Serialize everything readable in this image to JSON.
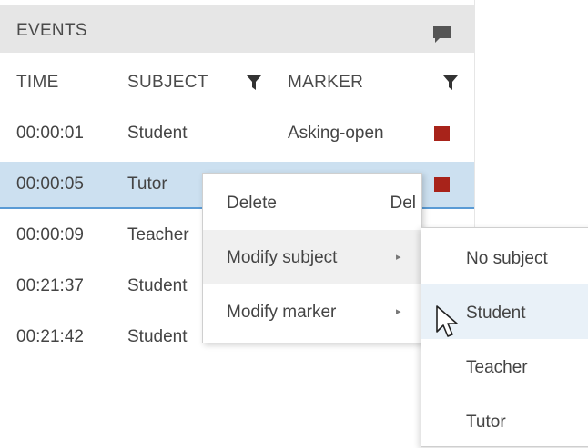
{
  "events_panel": {
    "title": "EVENTS",
    "header_icon": "comment-icon",
    "columns": {
      "time": "TIME",
      "subject": "SUBJECT",
      "marker": "MARKER"
    },
    "rows": [
      {
        "time": "00:00:01",
        "subject": "Student",
        "marker": "Asking-open",
        "marker_color": "#a8231a"
      },
      {
        "time": "00:00:05",
        "subject": "Tutor",
        "marker": "",
        "marker_color": "#a8231a",
        "selected": true
      },
      {
        "time": "00:00:09",
        "subject": "Teacher",
        "marker": "",
        "marker_color": "#a8231a"
      },
      {
        "time": "00:21:37",
        "subject": "Student",
        "marker": "",
        "marker_color": ""
      },
      {
        "time": "00:21:42",
        "subject": "Student",
        "marker": "",
        "marker_color": ""
      }
    ]
  },
  "context_menu": {
    "items": [
      {
        "label": "Delete",
        "shortcut": "Del"
      },
      {
        "label": "Modify subject",
        "submenu_arrow": "▸"
      },
      {
        "label": "Modify marker",
        "submenu_arrow": "▸"
      }
    ]
  },
  "subject_submenu": {
    "items": [
      "No subject",
      "Student",
      "Teacher",
      "Tutor"
    ],
    "hovered": "Student"
  },
  "colors": {
    "header_bg": "#e6e6e6",
    "selected_row_bg": "#cce0f0",
    "selected_row_border": "#5a9bd5",
    "marker_red": "#a8231a",
    "submenu_hover": "#e9f1f8"
  }
}
